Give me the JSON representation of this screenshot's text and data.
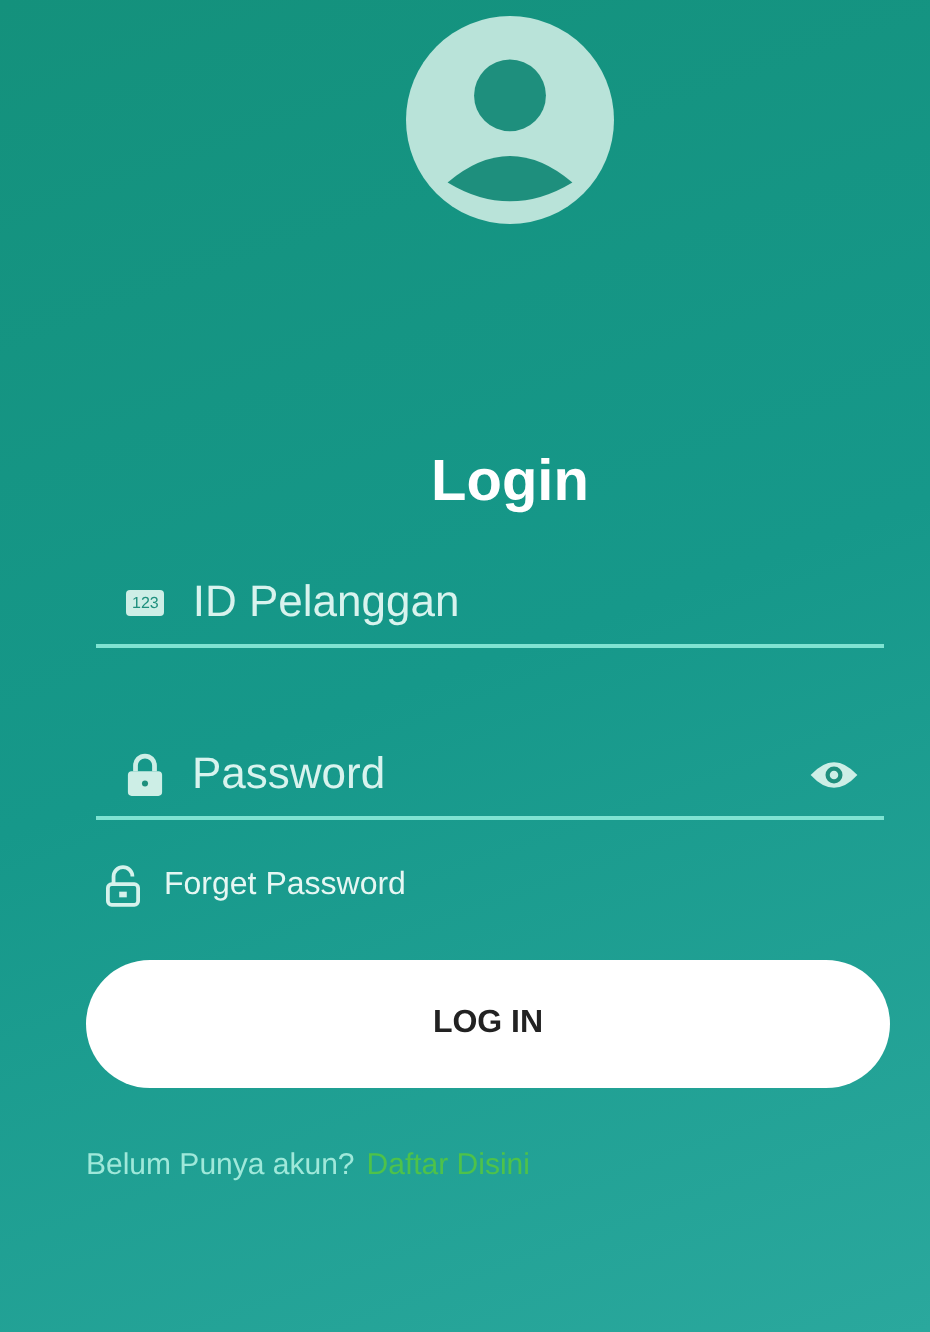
{
  "title": "Login",
  "fields": [
    {
      "kind": "id",
      "icon_text": "123",
      "placeholder": "ID Pelanggan"
    },
    {
      "kind": "password",
      "placeholder": "Password"
    }
  ],
  "forgot_link": "Forget Password",
  "login_button": "LOG IN",
  "signup": {
    "prompt": "Belum Punya akun?",
    "link": "Daftar Disini"
  }
}
